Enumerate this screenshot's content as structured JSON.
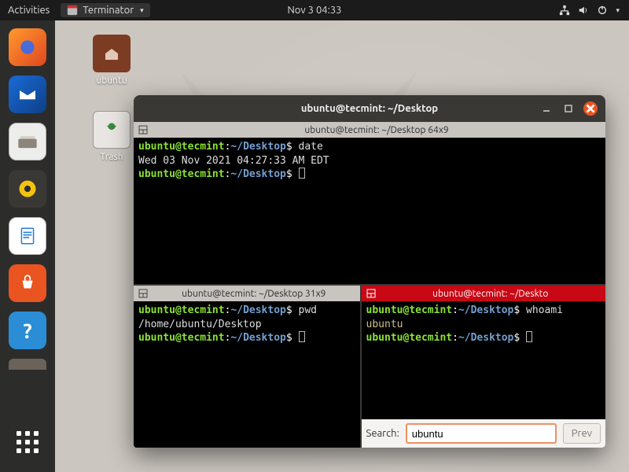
{
  "panel": {
    "activities": "Activities",
    "app": "Terminator",
    "clock": "Nov 3  04:33"
  },
  "desktop": {
    "home_label": "ubuntu",
    "trash_label": "Trash"
  },
  "window": {
    "title": "ubuntu@tecmint: ~/Desktop"
  },
  "panes": {
    "top": {
      "header": "ubuntu@tecmint: ~/Desktop 64x9",
      "lines": [
        {
          "user": "ubuntu",
          "at": "@",
          "host": "tecmint",
          "colon": ":",
          "path": "~/Desktop",
          "dollar": "$",
          "cmd": " date"
        },
        {
          "output": "Wed 03 Nov 2021 04:27:33 AM EDT"
        },
        {
          "user": "ubuntu",
          "at": "@",
          "host": "tecmint",
          "colon": ":",
          "path": "~/Desktop",
          "dollar": "$",
          "cmd": " "
        }
      ]
    },
    "bl": {
      "header": "ubuntu@tecmint: ~/Desktop 31x9",
      "lines": [
        {
          "user": "ubuntu",
          "at": "@",
          "host": "tecmint",
          "colon": ":",
          "path": "~/Desktop",
          "dollar": "$",
          "cmd": " pwd"
        },
        {
          "output": "/home/ubuntu/Desktop"
        },
        {
          "user": "ubuntu",
          "at": "@",
          "host": "tecmint",
          "colon": ":",
          "path": "~/Desktop",
          "dollar": "$",
          "cmd": " "
        }
      ]
    },
    "br": {
      "header": "ubuntu@tecmint: ~/Deskto",
      "lines": [
        {
          "user": "ubuntu",
          "at": "@",
          "host": "tecmint",
          "colon": ":",
          "path": "~/Desktop",
          "dollar": "$",
          "cmd": " whoami"
        },
        {
          "output_yellow": "ubuntu"
        },
        {
          "user": "ubuntu",
          "at": "@",
          "host": "tecmint",
          "colon": ":",
          "path": "~/Desktop",
          "dollar": "$",
          "cmd": " "
        }
      ]
    }
  },
  "search": {
    "label": "Search:",
    "value": "ubuntu",
    "prev": "Prev"
  }
}
